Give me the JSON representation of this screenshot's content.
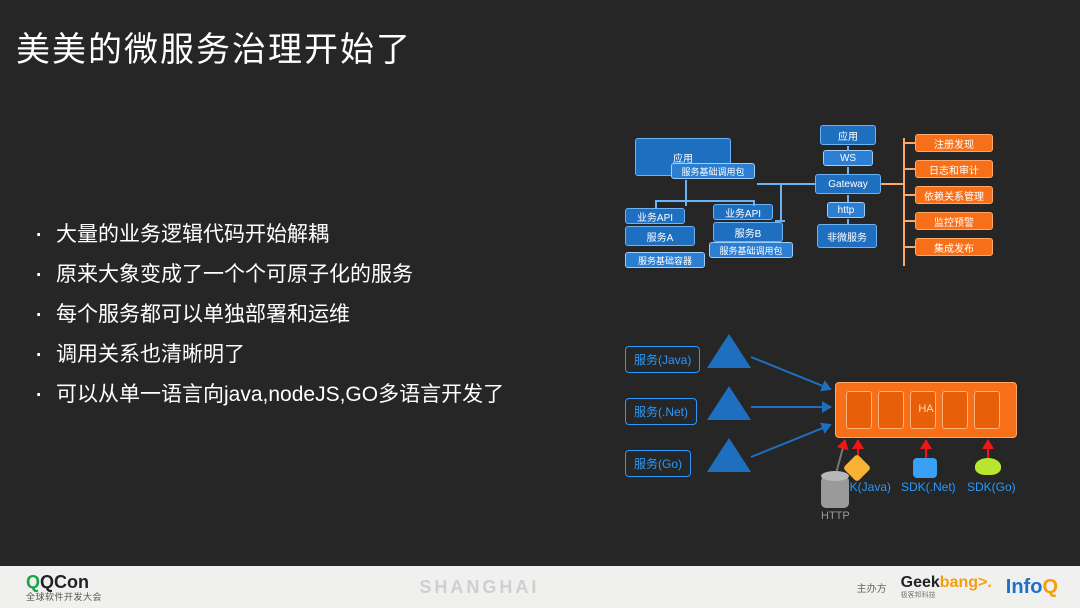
{
  "slide_title": "美美的微服务治理开始了",
  "bullets": [
    "大量的业务逻辑代码开始解耦",
    "原来大象变成了一个个可原子化的服务",
    "每个服务都可以单独部署和运维",
    "调用关系也清晰明了",
    "可以从单一语言向java,nodeJS,GO多语言开发了"
  ],
  "top_diagram": {
    "app1": "应用",
    "base_pkg1": "服务基础调用包",
    "biz_api1": "业务API",
    "svc_a": "服务A",
    "base_sub": "服务基础容器",
    "biz_api2": "业务API",
    "svc_b": "服务B",
    "base_pkg2": "服务基础调用包",
    "app2": "应用",
    "ws": "WS",
    "gateway": "Gateway",
    "http": "http",
    "non_ms": "非微服务",
    "side_items": [
      "注册发现",
      "日志和审计",
      "依赖关系管理",
      "监控预警",
      "集成发布"
    ]
  },
  "bottom_diagram": {
    "svc_java": "服务(Java)",
    "svc_net": "服务(.Net)",
    "svc_go": "服务(Go)",
    "ha": "HA",
    "sdk_java": "SDK(Java)",
    "sdk_net": "SDK(.Net)",
    "sdk_go": "SDK(Go)",
    "http": "HTTP"
  },
  "footer": {
    "qcon": "QCon",
    "qcon_sub": "全球软件开发大会",
    "city": "SHANGHAI",
    "host_label": "主办方",
    "geekbang": "Geekbang",
    "geekbang_sub": "极客邦科技",
    "infoq": "InfoQ"
  }
}
